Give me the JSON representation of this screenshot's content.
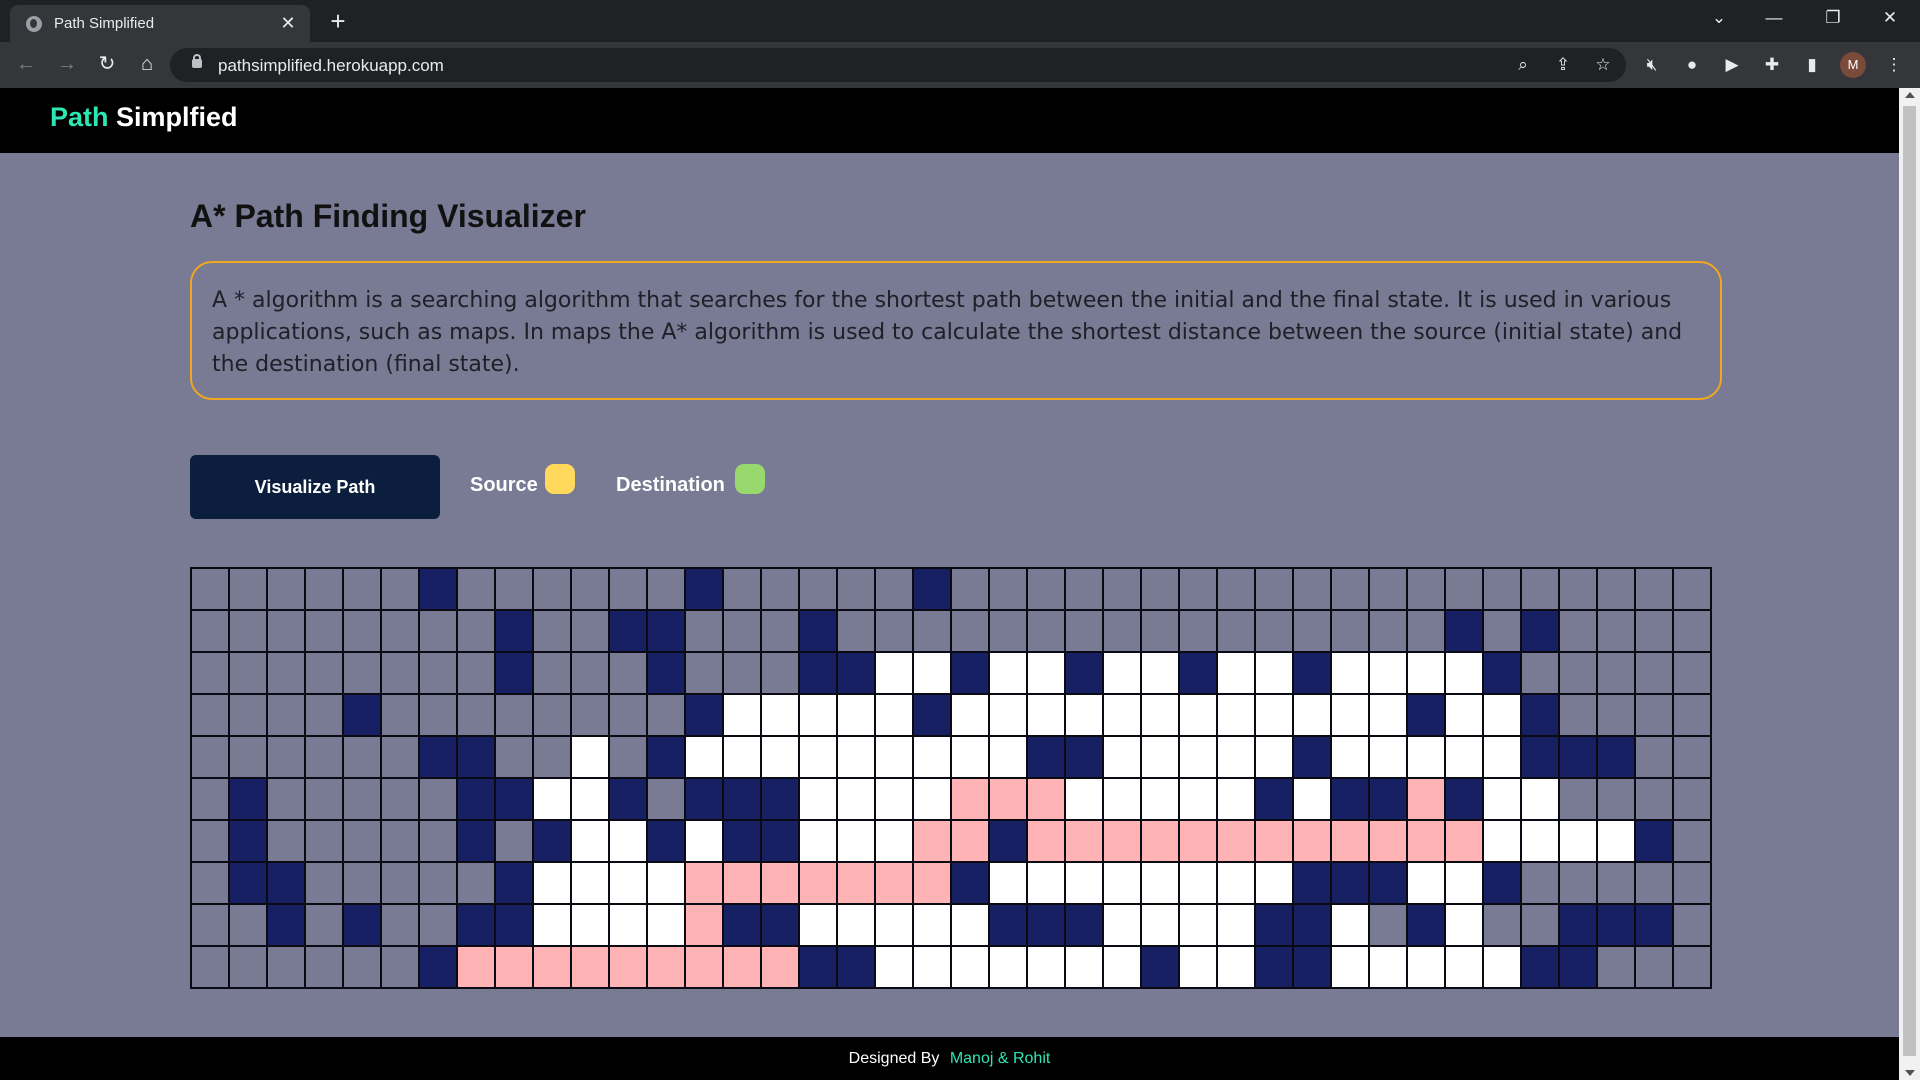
{
  "browser": {
    "tab_title": "Path Simplified",
    "tab_close": "✕",
    "new_tab": "+",
    "url": "pathsimplified.herokuapp.com",
    "profile_initial": "M"
  },
  "navbar": {
    "brand_part1": "Path",
    "brand_part2": "Simplfied"
  },
  "main": {
    "heading": "A* Path Finding Visualizer",
    "description": "A * algorithm is a searching algorithm that searches for the shortest path between the initial and the final state. It is used in various applications, such as maps. In maps the A* algorithm is used to calculate the shortest distance between the source (initial state) and the destination (final state).",
    "visualize_button": "Visualize Path",
    "legend": [
      {
        "label": "Source",
        "color": "#ffd85c"
      },
      {
        "label": "Destination",
        "color": "#98d86c"
      }
    ]
  },
  "grid": {
    "legend": {
      "e": "empty",
      "w": "wall",
      "v": "visited",
      "p": "path"
    },
    "colors": {
      "empty": "#797a93",
      "wall": "#162063",
      "visited": "#ffffff",
      "path": "#ffb3b5"
    },
    "rows": [
      "eeeeeeweeeeeeweeeeeweeeeeeeeeeeeeeeeeeeew",
      "eeeeeeeeweewweeeweeeeeeeeeeeeeeeeweweeeew",
      "eeeeeeeeweeeweeewwvvwvvwvvwvvwvvvvweeeeee",
      "eeeeweeeeeeeewvvvvvwvvvvvvvvvvvvwvvweeeee",
      "eeeeeewweevewvvvvvvvvvwwvvvvvwvvvvvwwweee",
      "eweeeeewwvvwewwwvvvvpppvvvvvwvwwpwvveeeew",
      "eweeeeewewvvwvwwvvvppwppppppppppppvvvvweew",
      "ewweeeeewvvvvpppppppwvvvvvvvvwwwvvweeeee",
      "eeweweewwvvvvpwwvvvvvwwwvvvvwwvewveewwwe",
      "eeeeeewpppppppppwwvvvvvvvwvvwwvvvvvwweeeww"
    ]
  },
  "footer": {
    "label": "Designed By",
    "names": "Manoj & Rohit"
  }
}
